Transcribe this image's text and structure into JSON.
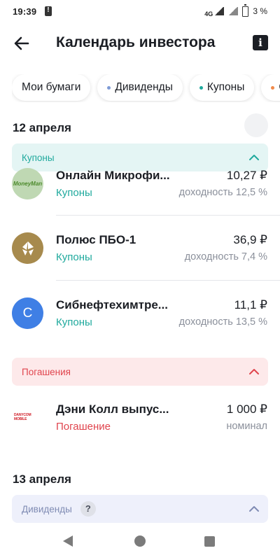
{
  "status_bar": {
    "time": "19:39",
    "network": "4G",
    "battery": "3 %"
  },
  "header": {
    "title": "Календарь инвестора",
    "info_label": "i"
  },
  "filters": [
    {
      "label": "Мои бумаги",
      "dot_color": null
    },
    {
      "label": "Дивиденды",
      "dot_color": "#7e9bd6"
    },
    {
      "label": "Купоны",
      "dot_color": "#1fa99d"
    },
    {
      "label": "Ог",
      "dot_color": "#f08a4b"
    }
  ],
  "days": [
    {
      "date": "12 апреля",
      "sections": [
        {
          "title": "Купоны",
          "kind": "coupons",
          "items": [
            {
              "name": "Онлайн Микрофи...",
              "type": "Купоны",
              "amount": "10,27 ₽",
              "meta": "доходность 12,5 %",
              "logo_text": "MoneyMan"
            },
            {
              "name": "Полюс ПБО-1",
              "type": "Купоны",
              "amount": "36,9 ₽",
              "meta": "доходность 7,4 %",
              "logo_text": ""
            },
            {
              "name": "Сибнефтехимтре...",
              "type": "Купоны",
              "amount": "11,1 ₽",
              "meta": "доходность 13,5 %",
              "logo_text": "C"
            }
          ]
        },
        {
          "title": "Погашения",
          "kind": "repay",
          "items": [
            {
              "name": "Дэни Колл выпус...",
              "type": "Погашение",
              "amount": "1 000 ₽",
              "meta": "номинал",
              "logo_text": "DANYCOM MOBILE"
            }
          ]
        }
      ]
    },
    {
      "date": "13 апреля",
      "sections": [
        {
          "title": "Дивиденды",
          "kind": "divs",
          "help": "?"
        }
      ]
    }
  ],
  "colors": {
    "coupon": "#1fa99d",
    "repay": "#e0444d",
    "dividend": "#7f8bb3"
  }
}
